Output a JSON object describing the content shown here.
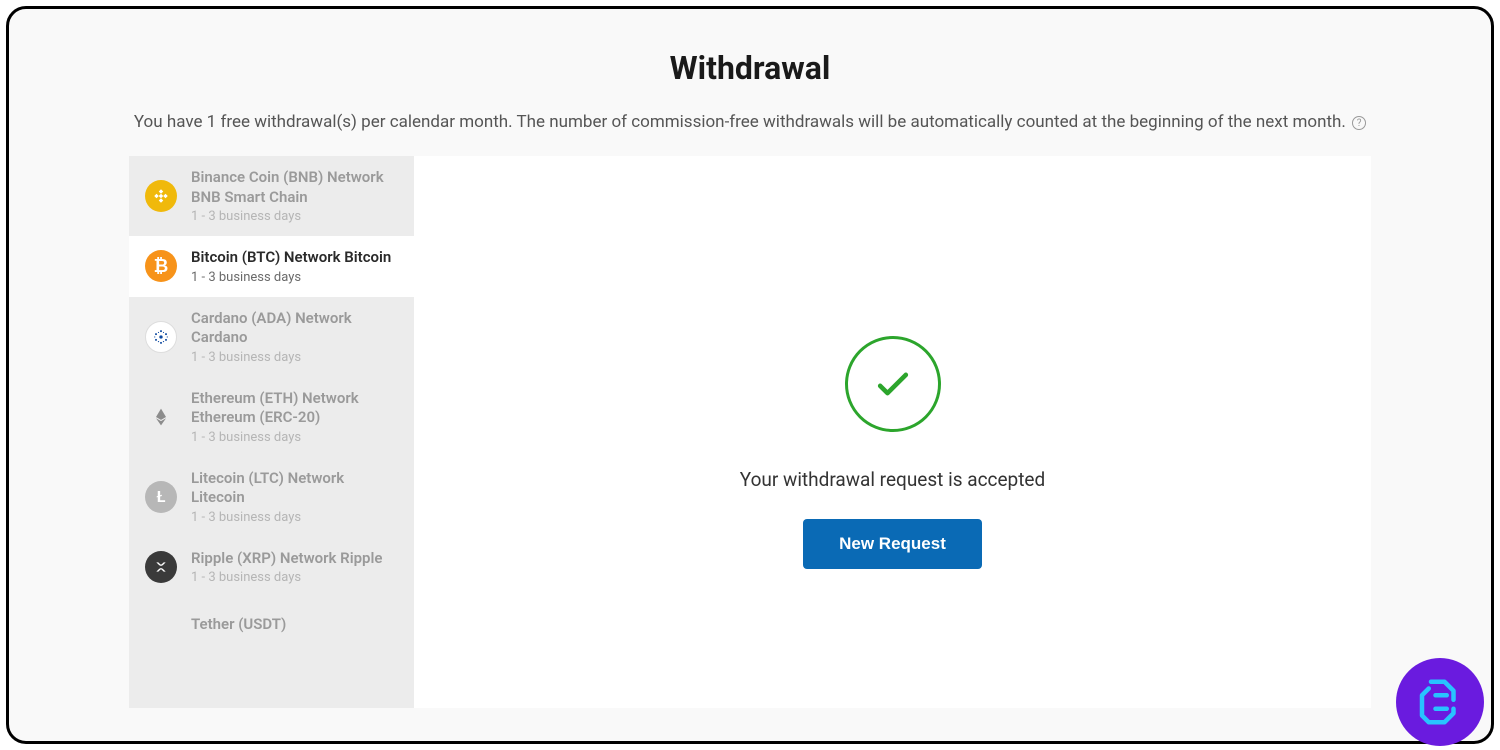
{
  "header": {
    "title": "Withdrawal",
    "subtitle": "You have 1 free withdrawal(s) per calendar month. The number of commission-free withdrawals will be automatically counted at the beginning of the next month."
  },
  "sidebar": {
    "items": [
      {
        "name": "Binance Coin (BNB) Network BNB Smart Chain",
        "time": "1 - 3 business days",
        "selected": false,
        "icon": "bnb"
      },
      {
        "name": "Bitcoin (BTC) Network Bitcoin",
        "time": "1 - 3 business days",
        "selected": true,
        "icon": "btc"
      },
      {
        "name": "Cardano (ADA) Network Cardano",
        "time": "1 - 3 business days",
        "selected": false,
        "icon": "ada"
      },
      {
        "name": "Ethereum (ETH) Network Ethereum (ERC-20)",
        "time": "1 - 3 business days",
        "selected": false,
        "icon": "eth"
      },
      {
        "name": "Litecoin (LTC) Network Litecoin",
        "time": "1 - 3 business days",
        "selected": false,
        "icon": "ltc"
      },
      {
        "name": "Ripple (XRP) Network Ripple",
        "time": "1 - 3 business days",
        "selected": false,
        "icon": "xrp"
      },
      {
        "name": "Tether (USDT)",
        "time": "",
        "selected": false,
        "icon": "usdt"
      }
    ]
  },
  "main": {
    "status_message": "Your withdrawal request is accepted",
    "button_label": "New Request"
  }
}
